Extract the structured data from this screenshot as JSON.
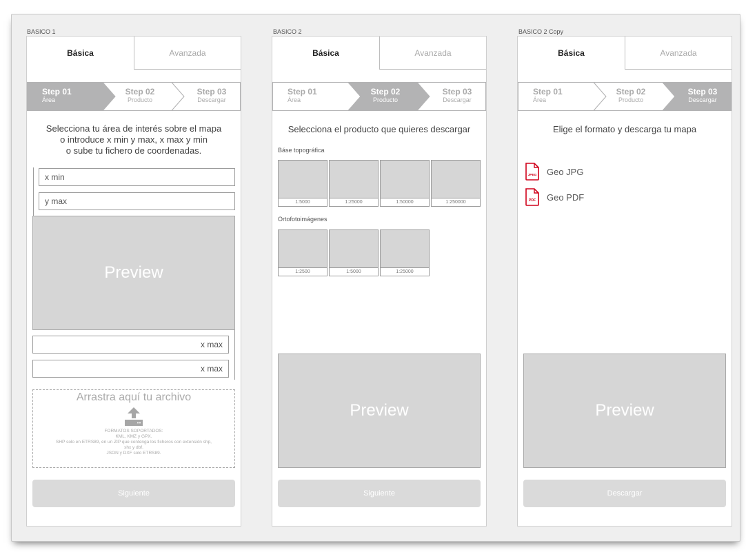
{
  "artboards": [
    {
      "label": "BASICO 1"
    },
    {
      "label": "BASICO 2"
    },
    {
      "label": "BASICO 2 Copy"
    }
  ],
  "tabs": {
    "basic": "Básica",
    "advanced": "Avanzada"
  },
  "steps": [
    {
      "title": "Step 01",
      "sub": "Área"
    },
    {
      "title": "Step 02",
      "sub": "Producto"
    },
    {
      "title": "Step 03",
      "sub": "Descargar"
    }
  ],
  "board1": {
    "headline": [
      "Selecciona tu área de interés sobre el mapa",
      "o introduce x min y max, x max y min",
      "o sube tu fichero de coordenadas."
    ],
    "xmin_placeholder": "x min",
    "ymax_placeholder": "y max",
    "preview": "Preview",
    "xmax_1": "x max",
    "xmax_2": "x max",
    "dropzone": {
      "title": "Arrastra aquí tu archivo",
      "lines": [
        "FORMATOS SOPORTADOS:",
        "KML, KMZ y GPX.",
        "SHP solo en ETRS89, en un ZIP que contenga los ficheros con extensión shp,",
        "shx y dbf.",
        "JSON y DXF solo ETRS89."
      ]
    },
    "button": "Siguiente"
  },
  "board2": {
    "headline": "Selecciona el producto que quieres descargar",
    "topo_label": "Báse topográfica",
    "topo_scales": [
      "1:5000",
      "1:25000",
      "1:50000",
      "1:250000"
    ],
    "orto_label": "Ortofotoimágenes",
    "orto_scales": [
      "1:2500",
      "1:5000",
      "1:25000"
    ],
    "preview": "Preview",
    "button": "Siguiente"
  },
  "board3": {
    "headline": "Elige el formato y descarga tu mapa",
    "formats": [
      {
        "label": "Geo JPG",
        "badge": "JPEG",
        "icon": "jpeg-file-icon"
      },
      {
        "label": "Geo PDF",
        "badge": "PDF",
        "icon": "pdf-file-icon"
      }
    ],
    "preview": "Preview",
    "button": "Descargar"
  },
  "colors": {
    "accent_step": "#b3b3b4",
    "file_icon": "#d0021b",
    "button_disabled": "#dadada"
  }
}
